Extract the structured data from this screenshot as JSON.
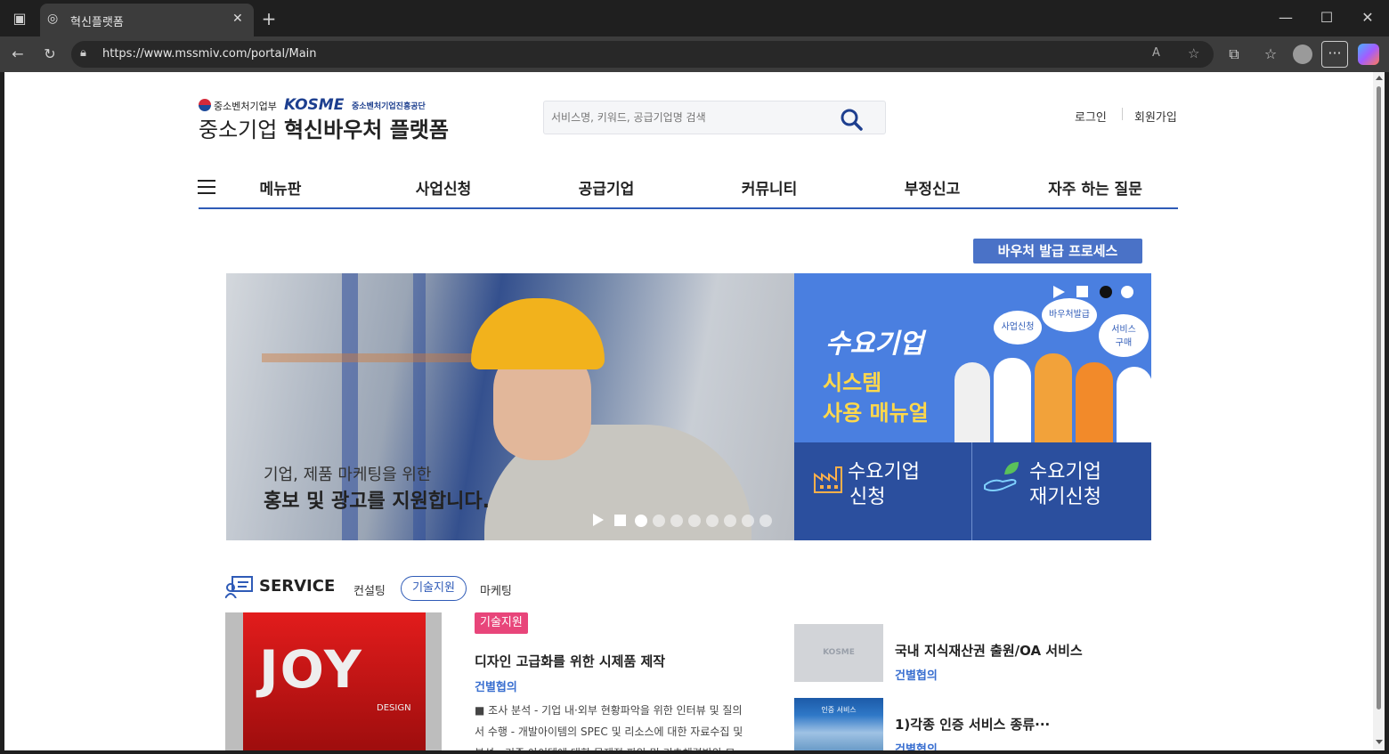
{
  "browser": {
    "tab_title": "혁신플랫폼",
    "url": "https://www.mssmiv.com/portal/Main"
  },
  "header": {
    "ministry": "중소벤처기업부",
    "kosme_logo": "KOSME",
    "kosme_name": "중소벤처기업진흥공단",
    "site_title_prefix": "중소기업",
    "site_title_main": "혁신바우처 플랫폼",
    "search_placeholder": "서비스명, 키워드, 공급기업명 검색",
    "login": "로그인",
    "signup": "회원가입"
  },
  "nav": {
    "items": [
      "메뉴판",
      "사업신청",
      "공급기업",
      "커뮤니티",
      "부정신고",
      "자주 하는 질문"
    ]
  },
  "voucher_button": "바우처 발급 프로세스",
  "hero": {
    "caption_line1": "기업, 제품 마케팅을 위한",
    "caption_line2": "홍보 및 광고를 지원합니다.",
    "slide_count": 8,
    "active_slide": 1
  },
  "side_banner": {
    "title1": "수요기업",
    "title2": "시스템",
    "title3": "사용 매뉴얼",
    "bubble1": "사업신청",
    "bubble2": "바우처발급",
    "bubble3": "서비스",
    "bubble3b": "구매",
    "active_slide": 1,
    "btn1_line1": "수요기업",
    "btn1_line2": "신청",
    "btn2_line1": "수요기업",
    "btn2_line2": "재기신청"
  },
  "service": {
    "heading": "SERVICE",
    "tabs": [
      "컨설팅",
      "기술지원",
      "마케팅"
    ],
    "active_tab": "기술지원",
    "featured": {
      "image_text": "JOY",
      "image_subtext": "DESIGN",
      "badge": "기술지원",
      "title": "디자인 고급화를 위한 시제품 제작",
      "price": "건별협의",
      "desc_line1": "■  조사 분석 - 기업 내·외부 현황파악을 위한 인터뷰 및 질의",
      "desc_line2": "서 수행 - 개발아이템의 SPEC 및 리소스에 대한 자료수집 및",
      "desc_line3": "분석 - 기존 아이템에 대한 문제점 파악 및 기초체력방안 모"
    },
    "list": [
      {
        "thumb_text": "KOSME",
        "title": "국내 지식재산권 출원/OA 서비스",
        "price": "건별협의"
      },
      {
        "thumb_text": "인증 서비스",
        "title": "1)각종 인증 서비스 종류···",
        "price": "건별협의"
      }
    ]
  },
  "colors": {
    "accent_blue": "#2f5bb7",
    "navy": "#1e3f8f",
    "banner_blue": "#4a7fe0",
    "badge_pink": "#e8457a",
    "price_blue": "#3a6fd0"
  }
}
